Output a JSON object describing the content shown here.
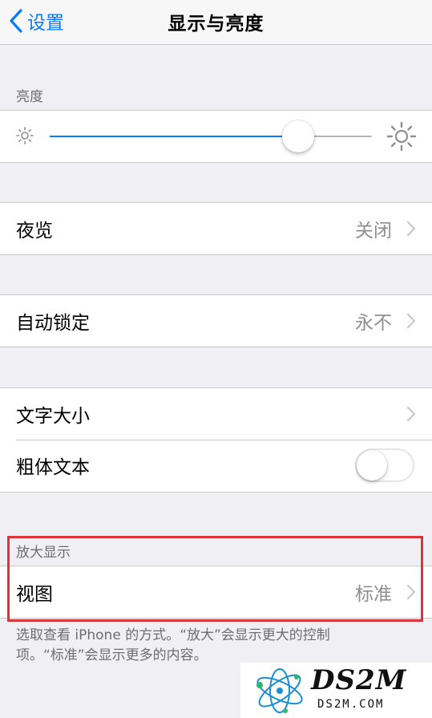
{
  "navbar": {
    "back_label": "设置",
    "title": "显示与亮度"
  },
  "brightness": {
    "section_label": "亮度",
    "level_percent": 77
  },
  "night_shift": {
    "label": "夜览",
    "value": "关闭"
  },
  "auto_lock": {
    "label": "自动锁定",
    "value": "永不"
  },
  "text": {
    "text_size_label": "文字大小",
    "bold_text_label": "粗体文本",
    "bold_text_on": false
  },
  "zoom": {
    "section_label": "放大显示",
    "view_label": "视图",
    "view_value": "标准",
    "footer_note": "选取查看 iPhone 的方式。“放大”会显示更大的控制项。“标准”会显示更多的内容。"
  },
  "watermark": {
    "logo_text": "DS2M",
    "url_text": "DS2M.COM"
  },
  "colors": {
    "accent": "#0a7aff",
    "highlight": "#d9353b",
    "background": "#efeff4"
  },
  "icons": {
    "back": "chevron-left-icon",
    "brightness_low": "sun-small-icon",
    "brightness_high": "sun-large-icon",
    "disclosure": "chevron-right-icon"
  }
}
